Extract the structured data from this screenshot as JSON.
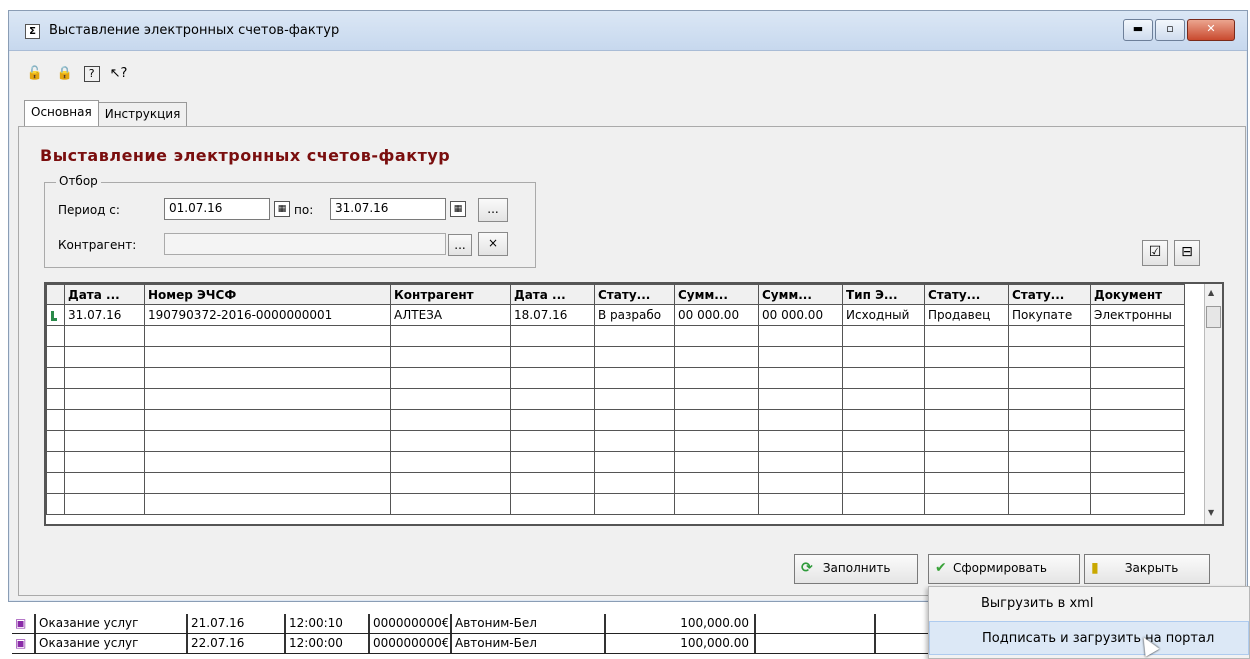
{
  "window": {
    "title": "Выставление электронных счетов-фактур",
    "icon_glyph": "Σ",
    "controls": {
      "minimize": "▬",
      "maximize": "▫",
      "close": "✕"
    }
  },
  "toolbar": {
    "icons": [
      "lock-icon",
      "unlock-icon",
      "help-icon",
      "context-help-icon"
    ],
    "glyphs": [
      "🔓",
      "🔒",
      "?",
      "↖?"
    ]
  },
  "tabs": [
    {
      "label": "Основная"
    },
    {
      "label": "Инструкция"
    }
  ],
  "heading": "Выставление электронных счетов-фактур",
  "filter": {
    "group_label": "Отбор",
    "period_label": "Период с:",
    "date_from": "01.07.16",
    "to_label": "по:",
    "date_to": "31.07.16",
    "period_btn": "...",
    "counterparty_label": "Контрагент:",
    "counterparty_value": "",
    "counterparty_btn": "...",
    "clear_btn": "×"
  },
  "grid": {
    "columns": [
      "Дата ...",
      "Номер ЭЧСФ",
      "Контрагент",
      "Дата ...",
      "Стату...",
      "Сумм...",
      "Сумм...",
      "Тип Э...",
      "Стату...",
      "Стату...",
      "Документ"
    ],
    "rows": [
      [
        "31.07.16",
        "190790372-2016-0000000001",
        "АЛТЕЗА",
        "18.07.16",
        "В разрабо",
        "00 000.00",
        "00 000.00",
        "Исходный",
        "Продавец",
        "Покупате",
        "Электронны"
      ]
    ]
  },
  "actions": {
    "fill": "Заполнить",
    "form": "Сформировать",
    "close": "Закрыть"
  },
  "background_rows": [
    [
      "Оказание услуг",
      "21.07.16",
      "12:00:10",
      "000000000€",
      "Автоним-Бел",
      "100,000.00"
    ],
    [
      "Оказание услуг",
      "22.07.16",
      "12:00:00",
      "000000000€",
      "Автоним-Бел",
      "100,000.00"
    ]
  ],
  "context_menu": [
    "Выгрузить в xml",
    "Подписать и загрузить на портал"
  ]
}
